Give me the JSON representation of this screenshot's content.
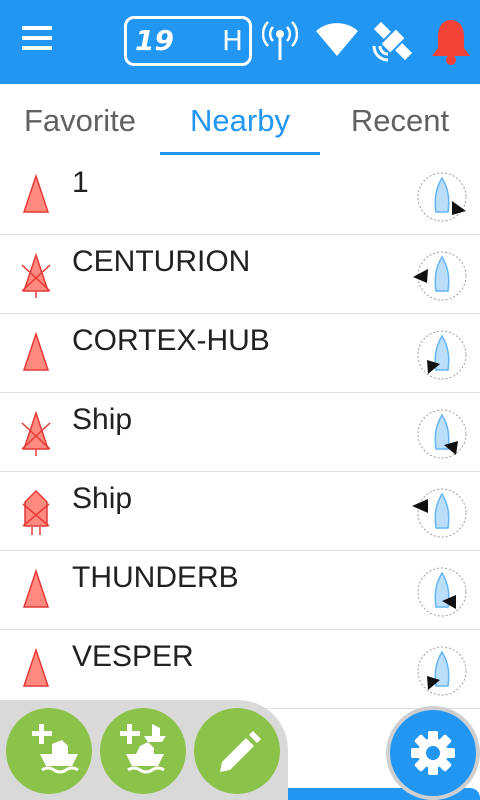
{
  "topbar": {
    "channel": "19",
    "power": "H",
    "icons": [
      "menu-icon",
      "antenna-icon",
      "wifi-icon",
      "gps-satellite-icon",
      "alarm-bell-icon"
    ],
    "colors": {
      "bar": "#2196f3",
      "alarm": "#f44336"
    }
  },
  "tabs": [
    {
      "label": "Favorite",
      "active": false
    },
    {
      "label": "Nearby",
      "active": true
    },
    {
      "label": "Recent",
      "active": false
    }
  ],
  "contacts": [
    {
      "name": "1",
      "icon": "ais-vessel-triangle-icon"
    },
    {
      "name": "CENTURION",
      "icon": "ais-vessel-crossed-icon"
    },
    {
      "name": "CORTEX-HUB",
      "icon": "ais-vessel-triangle-icon"
    },
    {
      "name": "Ship",
      "icon": "ais-vessel-crossed-icon"
    },
    {
      "name": "Ship",
      "icon": "ais-vessel-crossed-shaped-icon"
    },
    {
      "name": "THUNDERB",
      "icon": "ais-vessel-triangle-icon"
    },
    {
      "name": "VESPER",
      "icon": "ais-vessel-triangle-icon"
    }
  ],
  "actions": {
    "fabs": [
      "add-vessel-icon",
      "add-group-vessel-icon",
      "edit-pencil-icon"
    ],
    "settings": "settings-gear-icon",
    "colors": {
      "fab": "#8bc34a",
      "settings": "#2196f3"
    }
  }
}
